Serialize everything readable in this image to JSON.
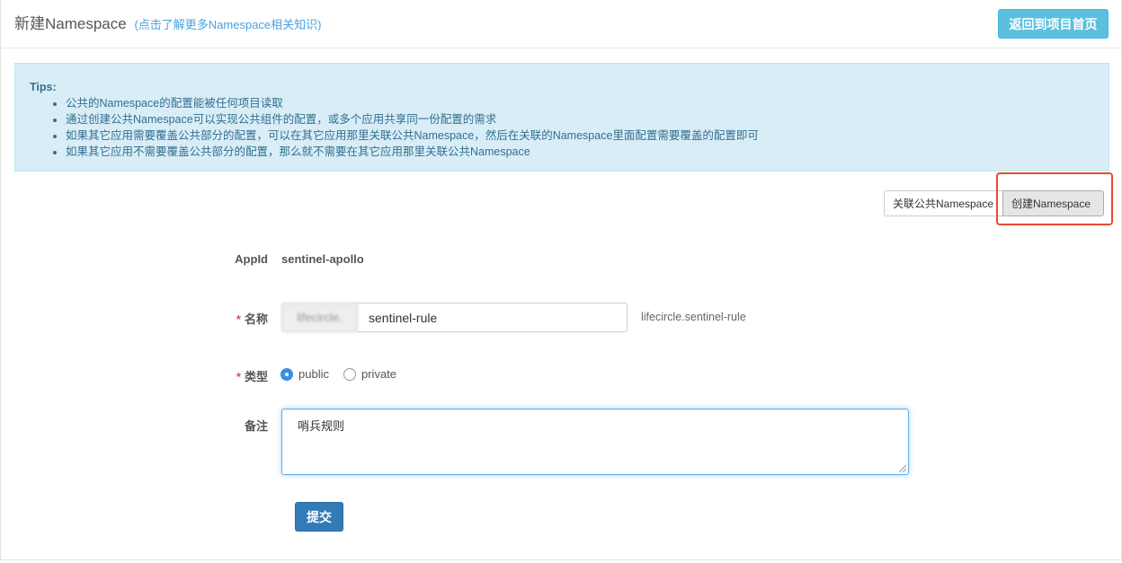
{
  "header": {
    "title": "新建Namespace",
    "help_link": "(点击了解更多Namespace相关知识)",
    "back_button": "返回到项目首页"
  },
  "tips": {
    "title": "Tips:",
    "items": [
      "公共的Namespace的配置能被任何项目读取",
      "通过创建公共Namespace可以实现公共组件的配置，或多个应用共享同一份配置的需求",
      "如果其它应用需要覆盖公共部分的配置，可以在其它应用那里关联公共Namespace，然后在关联的Namespace里面配置需要覆盖的配置即可",
      "如果其它应用不需要覆盖公共部分的配置，那么就不需要在其它应用那里关联公共Namespace"
    ]
  },
  "mode_buttons": {
    "associate": "关联公共Namespace",
    "create": "创建Namespace",
    "active": "create"
  },
  "form": {
    "appid_label": "AppId",
    "appid_value": "sentinel-apollo",
    "required_mark": "*",
    "name_label": "名称",
    "name_prefix": "lifecircle.",
    "name_value": "sentinel-rule",
    "full_name": "lifecircle.sentinel-rule",
    "type_label": "类型",
    "type_options": [
      "public",
      "private"
    ],
    "type_selected": "public",
    "comment_label": "备注",
    "comment_value": "哨兵规则",
    "submit": "提交"
  },
  "colors": {
    "info_button": "#5bc0de",
    "primary_button": "#337ab7",
    "tips_background": "#d9edf7",
    "tips_text": "#31708f",
    "highlight_border": "#e84a2f",
    "required": "#d9534f"
  }
}
